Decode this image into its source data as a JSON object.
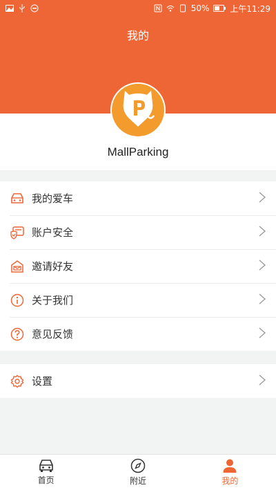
{
  "status_bar": {
    "battery": "50%",
    "time": "上午11:29"
  },
  "header": {
    "title": "我的"
  },
  "profile": {
    "username": "MallParking"
  },
  "menu_group_1": [
    {
      "label": "我的爱车",
      "icon": "car-icon"
    },
    {
      "label": "账户安全",
      "icon": "shield-card-icon"
    },
    {
      "label": "邀请好友",
      "icon": "invite-house-icon"
    },
    {
      "label": "关于我们",
      "icon": "info-icon"
    },
    {
      "label": "意见反馈",
      "icon": "question-icon"
    }
  ],
  "menu_group_2": [
    {
      "label": "设置",
      "icon": "gear-icon"
    }
  ],
  "tabbar": [
    {
      "label": "首页",
      "icon": "car-icon",
      "active": false
    },
    {
      "label": "附近",
      "icon": "compass-icon",
      "active": false
    },
    {
      "label": "我的",
      "icon": "person-icon",
      "active": true
    }
  ],
  "colors": {
    "accent": "#ee6635",
    "logo": "#f39b2d"
  }
}
